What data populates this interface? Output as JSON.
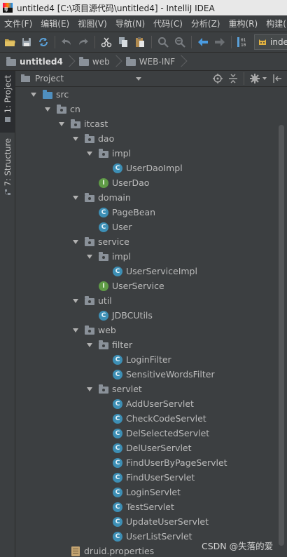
{
  "window": {
    "title": "untitled4 [C:\\项目源代码\\untitled4] - IntelliJ IDEA"
  },
  "menu": [
    "文件(F)",
    "编辑(E)",
    "视图(V)",
    "导航(N)",
    "代码(C)",
    "分析(Z)",
    "重构(R)",
    "构建(B)"
  ],
  "toolbar": {
    "run_config_label": "index"
  },
  "breadcrumbs": [
    "untitled4",
    "web",
    "WEB-INF"
  ],
  "left_tabs": {
    "project": "1: Project",
    "structure": "7: Structure"
  },
  "panel": {
    "title": "Project"
  },
  "tree": [
    {
      "label": "src",
      "level": 1,
      "kind": "source-folder",
      "expanded": true
    },
    {
      "label": "cn",
      "level": 2,
      "kind": "package",
      "expanded": true
    },
    {
      "label": "itcast",
      "level": 3,
      "kind": "package",
      "expanded": true
    },
    {
      "label": "dao",
      "level": 4,
      "kind": "package",
      "expanded": true
    },
    {
      "label": "impl",
      "level": 5,
      "kind": "package",
      "expanded": true
    },
    {
      "label": "UserDaoImpl",
      "level": 6,
      "kind": "class"
    },
    {
      "label": "UserDao",
      "level": 5,
      "kind": "interface"
    },
    {
      "label": "domain",
      "level": 4,
      "kind": "package",
      "expanded": true
    },
    {
      "label": "PageBean",
      "level": 5,
      "kind": "class"
    },
    {
      "label": "User",
      "level": 5,
      "kind": "class"
    },
    {
      "label": "service",
      "level": 4,
      "kind": "package",
      "expanded": true
    },
    {
      "label": "impl",
      "level": 5,
      "kind": "package",
      "expanded": true
    },
    {
      "label": "UserServiceImpl",
      "level": 6,
      "kind": "class"
    },
    {
      "label": "UserService",
      "level": 5,
      "kind": "interface"
    },
    {
      "label": "util",
      "level": 4,
      "kind": "package",
      "expanded": true
    },
    {
      "label": "JDBCUtils",
      "level": 5,
      "kind": "class"
    },
    {
      "label": "web",
      "level": 4,
      "kind": "package",
      "expanded": true
    },
    {
      "label": "filter",
      "level": 5,
      "kind": "package",
      "expanded": true
    },
    {
      "label": "LoginFilter",
      "level": 6,
      "kind": "class"
    },
    {
      "label": "SensitiveWordsFilter",
      "level": 6,
      "kind": "class"
    },
    {
      "label": "servlet",
      "level": 5,
      "kind": "package",
      "expanded": true
    },
    {
      "label": "AddUserServlet",
      "level": 6,
      "kind": "class"
    },
    {
      "label": "CheckCodeServlet",
      "level": 6,
      "kind": "class"
    },
    {
      "label": "DelSelectedServlet",
      "level": 6,
      "kind": "class"
    },
    {
      "label": "DelUserServlet",
      "level": 6,
      "kind": "class"
    },
    {
      "label": "FindUserByPageServlet",
      "level": 6,
      "kind": "class"
    },
    {
      "label": "FindUserServlet",
      "level": 6,
      "kind": "class"
    },
    {
      "label": "LoginServlet",
      "level": 6,
      "kind": "class"
    },
    {
      "label": "TestServlet",
      "level": 6,
      "kind": "class"
    },
    {
      "label": "UpdateUserServlet",
      "level": 6,
      "kind": "class"
    },
    {
      "label": "UserListServlet",
      "level": 6,
      "kind": "class"
    },
    {
      "label": "druid.properties",
      "level": 3,
      "kind": "properties"
    }
  ],
  "watermark": "CSDN @失落的爱"
}
